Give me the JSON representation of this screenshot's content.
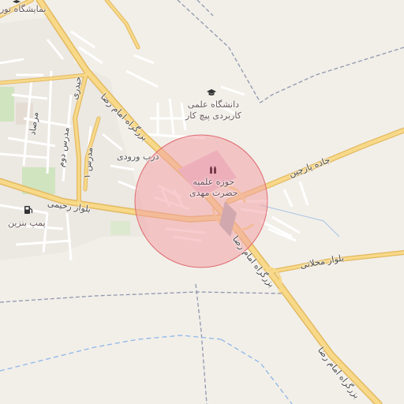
{
  "labels": {
    "university_top": "نمایشگاه تور",
    "university": "دانشگاه علمی\nکاربردی پیچ کار",
    "seminary": "حوزه علمیه\nحضرت مهدی",
    "darb_vorudi": "درب ورودی",
    "jadeh_parchin": "جاده پارچین",
    "bolvar_mahallati": "بلوار محلاتی",
    "bolvar_rahimi": "بلوار رحیمی",
    "pomp_benzin": "پمپ بنزین",
    "bozorgrah_1": "بزرگراه امام رضا",
    "bozorgrah_2": "بزرگراه امام رضا",
    "bozorgrah_3": "بزرگراه امام رضا",
    "morad_dovom": "مدرس دوم",
    "moradi": "مرصاد",
    "modares_1": "مدرس ۱",
    "haydari": "حیدری"
  },
  "icons": {
    "university": "graduation-cap-icon",
    "seminary": "religious-school-icon",
    "fuel": "fuel-pump-icon"
  },
  "colors": {
    "background": "#f2efe9",
    "major_road": "#f7d989",
    "major_road_casing": "#e3b960",
    "minor_road": "#ffffff",
    "circle_fill": "#f3a3a6",
    "circle_stroke": "#e06c72",
    "park": "#cfe4bf",
    "boundary": "#8f97ad",
    "water_dashed": "#8eb6e8"
  }
}
